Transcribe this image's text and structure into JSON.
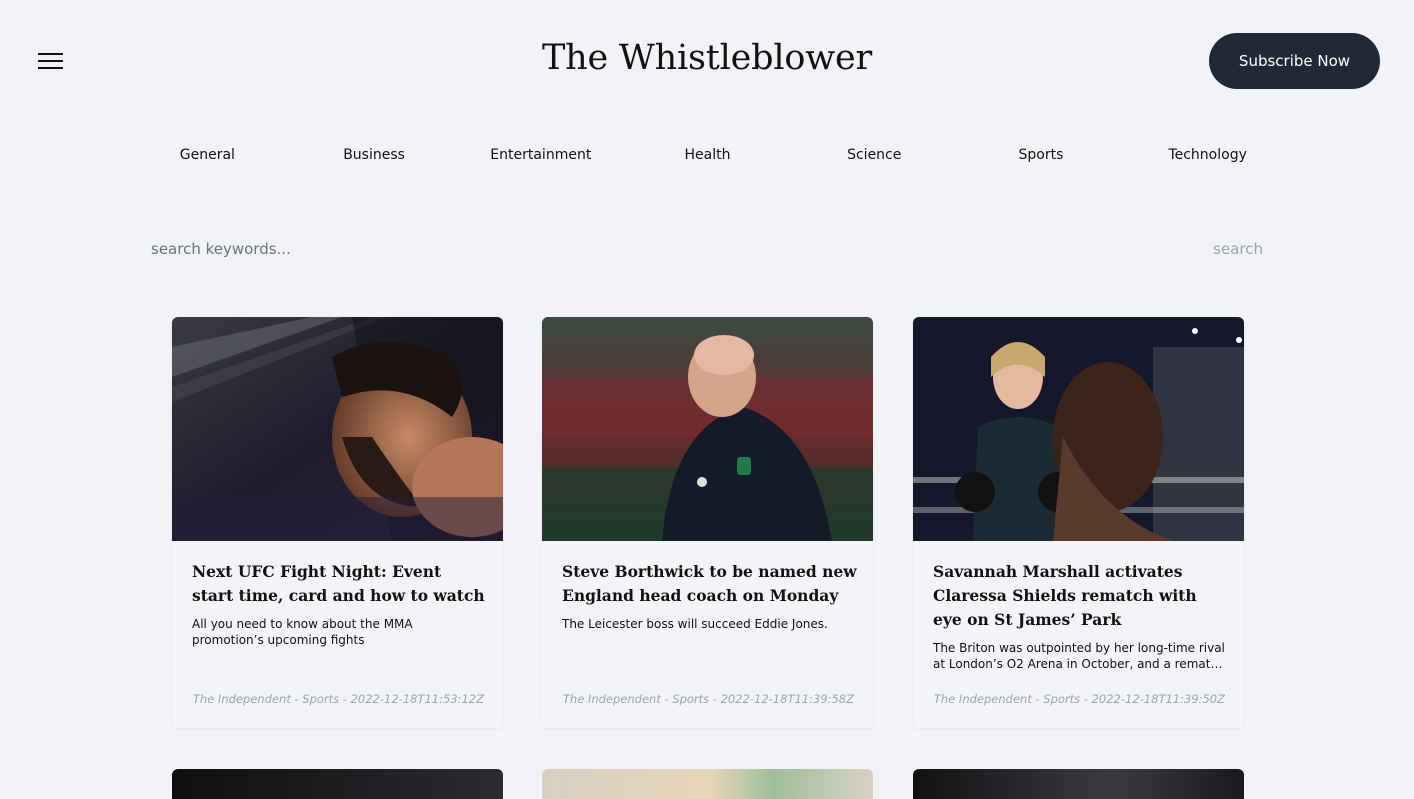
{
  "header": {
    "title": "The Whistleblower",
    "subscribe_label": "Subscribe Now",
    "menu_icon": "hamburger-menu-icon"
  },
  "categories": [
    "General",
    "Business",
    "Entertainment",
    "Health",
    "Science",
    "Sports",
    "Technology"
  ],
  "search": {
    "placeholder": "search keywords...",
    "value": "",
    "button_label": "search"
  },
  "articles": [
    {
      "title": "Next UFC Fight Night: Event start time, card and how to watch",
      "description": "All you need to know about the MMA promotion’s upcoming fights",
      "meta": "The Independent - Sports - 2022-12-18T11:53:12Z"
    },
    {
      "title": "Steve Borthwick to be named new England head coach on Monday",
      "description": "The Leicester boss will succeed Eddie Jones.",
      "meta": "The Independent - Sports - 2022-12-18T11:39:58Z"
    },
    {
      "title": "Savannah Marshall activates Claressa Shields rematch with eye on St James’ Park",
      "description": "The Briton was outpointed by her long-time rival at London’s O2 Arena in October, and a rematch could happen at St James’ Park next year.",
      "meta": "The Independent - Sports - 2022-12-18T11:39:50Z"
    }
  ]
}
